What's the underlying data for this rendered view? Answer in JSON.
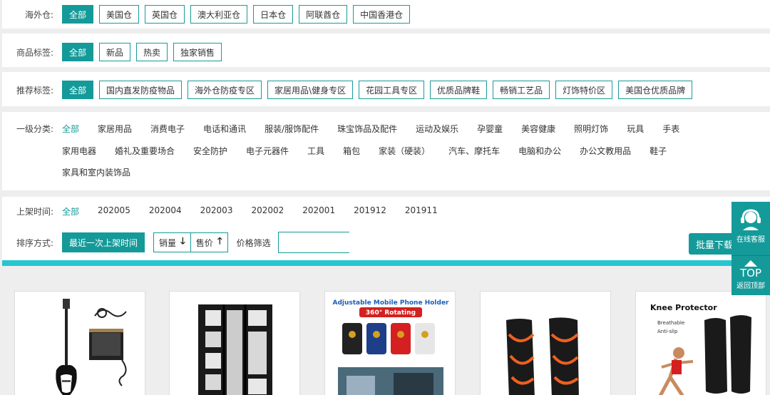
{
  "filters": {
    "warehouse": {
      "label": "海外仓:",
      "options": [
        "全部",
        "美国仓",
        "英国仓",
        "澳大利亚仓",
        "日本仓",
        "阿联酋仓",
        "中国香港仓"
      ]
    },
    "product_tags": {
      "label": "商品标签:",
      "options": [
        "全部",
        "新品",
        "热卖",
        "独家销售"
      ]
    },
    "recommend_tags": {
      "label": "推荐标签:",
      "options": [
        "全部",
        "国内直发防疫物品",
        "海外仓防疫专区",
        "家居用品\\健身专区",
        "花园工具专区",
        "优质品牌鞋",
        "畅销工艺品",
        "灯饰特价区",
        "美国仓优质品牌"
      ]
    },
    "category": {
      "label": "一级分类:",
      "row1": [
        "全部",
        "家居用品",
        "消费电子",
        "电话和通讯",
        "服装/服饰配件",
        "珠宝饰品及配件",
        "运动及娱乐",
        "孕婴童",
        "美容健康",
        "照明灯饰",
        "玩具",
        "手表"
      ],
      "row2": [
        "家用电器",
        "婚礼及重要场合",
        "安全防护",
        "电子元器件",
        "工具",
        "箱包",
        "家装（硬装）",
        "汽车、摩托车",
        "电脑和办公",
        "办公文教用品",
        "鞋子"
      ],
      "row3": [
        "家具和室内装饰品"
      ]
    },
    "listing_time": {
      "label": "上架时间:",
      "options": [
        "全部",
        "202005",
        "202004",
        "202003",
        "202002",
        "202001",
        "201912",
        "201911"
      ]
    }
  },
  "sort": {
    "label": "排序方式:",
    "latest": "最近一次上架时间",
    "sales": "销量",
    "price": "售价",
    "price_filter_label": "价格筛选"
  },
  "bulk_download": "批量下载",
  "side_widget": {
    "service": "在线客服",
    "top": "TOP",
    "top_sub": "返回顶部"
  },
  "products": [
    {
      "name": "bass-guitar-kit"
    },
    {
      "name": "fabric-wardrobe"
    },
    {
      "name": "mobile-phone-holder",
      "heading": "Adjustable Mobile Phone Holder",
      "badge": "360° Rotating"
    },
    {
      "name": "knee-sleeve"
    },
    {
      "name": "knee-protector",
      "heading": "Knee Protector",
      "sub1": "Breathable",
      "sub2": "Anti-slip"
    }
  ],
  "colors": {
    "accent": "#159a9a",
    "bar": "#26c6d0"
  }
}
